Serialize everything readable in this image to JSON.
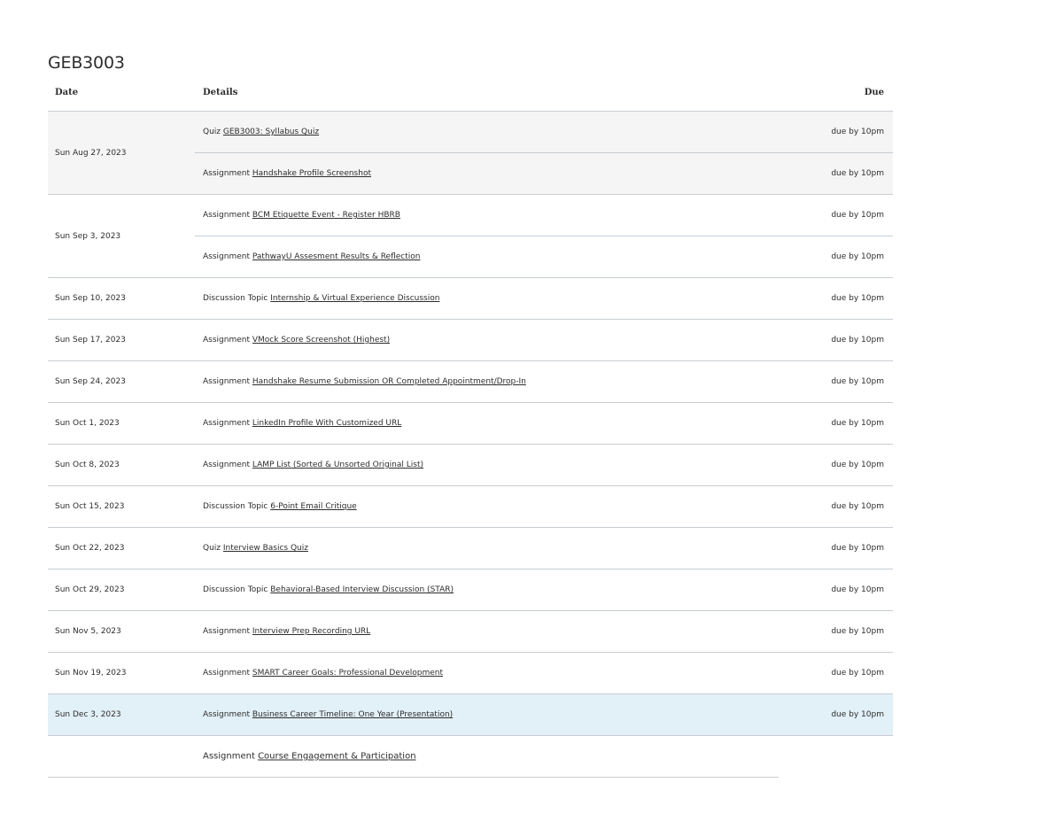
{
  "course": {
    "title": "GEB3003"
  },
  "columns": {
    "date": "Date",
    "details": "Details",
    "due": "Due"
  },
  "groups": [
    {
      "date": "Sun Aug 27, 2023",
      "style": "shaded",
      "items": [
        {
          "type": "Quiz",
          "link": "GEB3003: Syllabus Quiz",
          "due": "due by 10pm"
        },
        {
          "type": "Assignment",
          "link": "Handshake Profile Screenshot",
          "due": "due by 10pm"
        }
      ]
    },
    {
      "date": "Sun Sep 3, 2023",
      "style": "",
      "items": [
        {
          "type": "Assignment",
          "link": "BCM Etiquette Event - Register HBRB",
          "due": "due by 10pm"
        },
        {
          "type": "Assignment",
          "link": "PathwayU Assesment Results & Reflection",
          "due": "due by 10pm"
        }
      ]
    },
    {
      "date": "Sun Sep 10, 2023",
      "style": "",
      "items": [
        {
          "type": "Discussion Topic",
          "link": "Internship & Virtual Experience Discussion",
          "due": "due by 10pm"
        }
      ]
    },
    {
      "date": "Sun Sep 17, 2023",
      "style": "",
      "items": [
        {
          "type": "Assignment",
          "link": "VMock Score Screenshot (Highest)",
          "due": "due by 10pm"
        }
      ]
    },
    {
      "date": "Sun Sep 24, 2023",
      "style": "",
      "items": [
        {
          "type": "Assignment",
          "link": "Handshake Resume Submission OR Completed Appointment/Drop-In",
          "due": "due by 10pm"
        }
      ]
    },
    {
      "date": "Sun Oct 1, 2023",
      "style": "",
      "items": [
        {
          "type": "Assignment",
          "link": "LinkedIn Profile With Customized URL",
          "due": "due by 10pm"
        }
      ]
    },
    {
      "date": "Sun Oct 8, 2023",
      "style": "",
      "items": [
        {
          "type": "Assignment",
          "link": "LAMP List (Sorted & Unsorted Original List)",
          "due": "due by 10pm"
        }
      ]
    },
    {
      "date": "Sun Oct 15, 2023",
      "style": "",
      "items": [
        {
          "type": "Discussion Topic",
          "link": "6-Point Email Critique",
          "due": "due by 10pm"
        }
      ]
    },
    {
      "date": "Sun Oct 22, 2023",
      "style": "",
      "items": [
        {
          "type": "Quiz",
          "link": "Interview Basics Quiz",
          "due": "due by 10pm"
        }
      ]
    },
    {
      "date": "Sun Oct 29, 2023",
      "style": "",
      "items": [
        {
          "type": "Discussion Topic",
          "link": "Behavioral-Based Interview Discussion (STAR)",
          "due": "due by 10pm"
        }
      ]
    },
    {
      "date": "Sun Nov 5, 2023",
      "style": "",
      "items": [
        {
          "type": "Assignment",
          "link": "Interview Prep Recording URL",
          "due": "due by 10pm"
        }
      ]
    },
    {
      "date": "Sun Nov 19, 2023",
      "style": "",
      "items": [
        {
          "type": "Assignment",
          "link": "SMART Career Goals: Professional Development",
          "due": "due by 10pm"
        }
      ]
    },
    {
      "date": "Sun Dec 3, 2023",
      "style": "highlight",
      "items": [
        {
          "type": "Assignment",
          "link": "Business Career Timeline: One Year (Presentation)",
          "due": "due by 10pm"
        }
      ]
    },
    {
      "date": "",
      "style": "last",
      "items": [
        {
          "type": "Assignment",
          "link": "Course Engagement & Participation",
          "due": ""
        }
      ]
    }
  ]
}
